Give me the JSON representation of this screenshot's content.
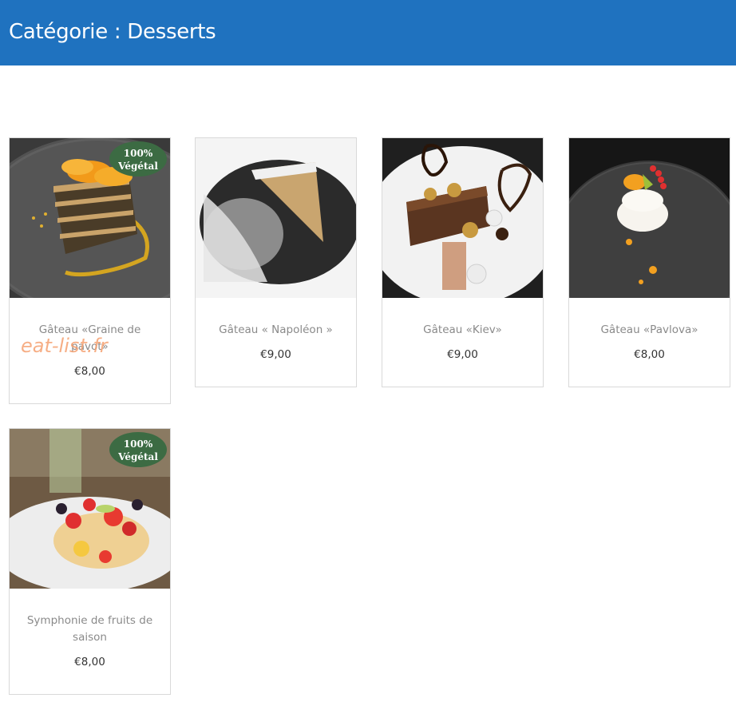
{
  "header": {
    "title": "Catégorie : Desserts"
  },
  "colors": {
    "header_bg": "#1f72bf",
    "badge_bg": "#3c6b43"
  },
  "products": [
    {
      "name": "Gâteau «Graine de pavot»",
      "price": "€8,00",
      "badge": {
        "line1": "100%",
        "line2": "Végétal"
      },
      "image_icon": "poppy-seed-cake-image"
    },
    {
      "name": "Gâteau « Napoléon »",
      "price": "€9,00",
      "image_icon": "napoleon-cake-image"
    },
    {
      "name": "Gâteau «Kiev»",
      "price": "€9,00",
      "image_icon": "kiev-cake-image"
    },
    {
      "name": "Gâteau «Pavlova»",
      "price": "€8,00",
      "image_icon": "pavlova-image"
    },
    {
      "name": "Symphonie de fruits de saison",
      "price": "€8,00",
      "badge": {
        "line1": "100%",
        "line2": "Végétal"
      },
      "image_icon": "fruit-symphony-image"
    }
  ],
  "watermark": "eat-list.fr"
}
